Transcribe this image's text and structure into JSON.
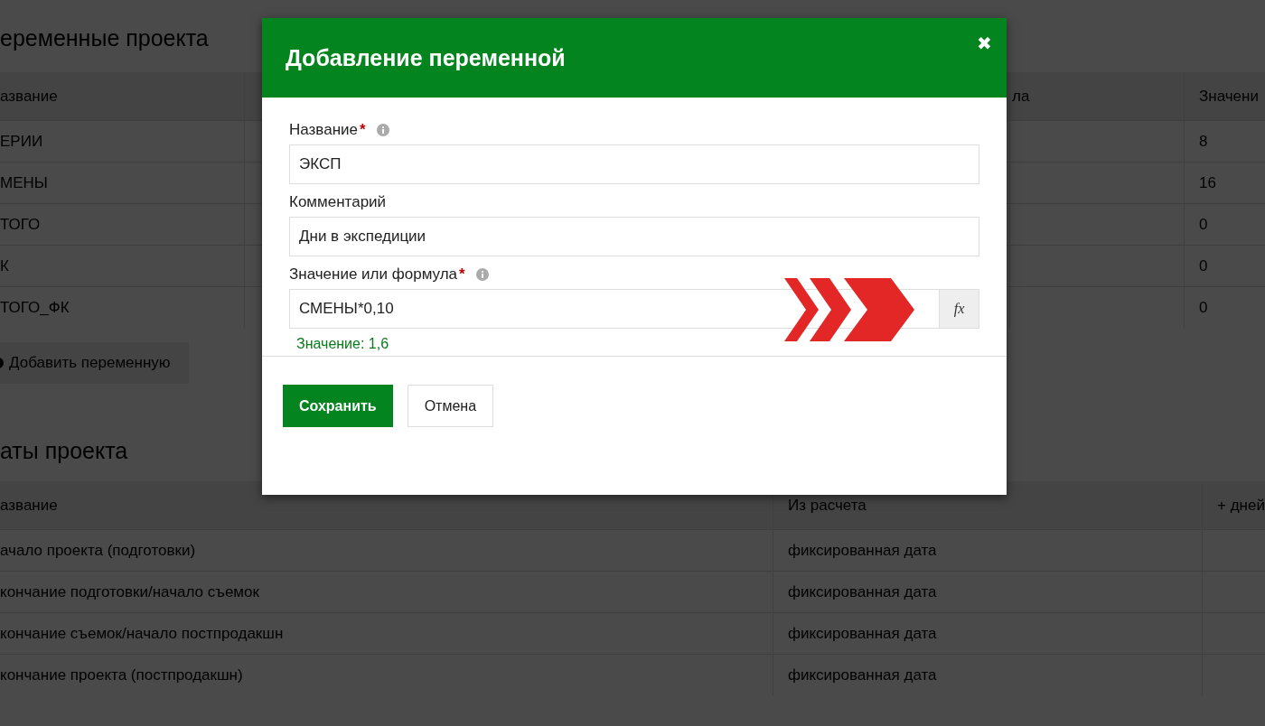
{
  "page": {
    "sections": [
      {
        "title": "еременные проекта",
        "table": {
          "columns": [
            {
              "label": "азвание"
            },
            {},
            {
              "label": "ла"
            },
            {
              "label": "Значени"
            }
          ],
          "rows": [
            [
              "ЕРИИ",
              null,
              null,
              "8"
            ],
            [
              "МЕНЫ",
              null,
              null,
              "16"
            ],
            [
              "ТОГО",
              null,
              null,
              "0"
            ],
            [
              "К",
              null,
              null,
              "0"
            ],
            [
              "ТОГО_ФК",
              null,
              null,
              "0"
            ]
          ]
        },
        "add_button": {
          "label": "Добавить переменную"
        }
      },
      {
        "title": "аты проекта",
        "table": {
          "columns": [
            {
              "label": "азвание"
            },
            {
              "label": "Из расчета"
            },
            {
              "label": "+ дней"
            }
          ],
          "rows": [
            [
              "ачало проекта (подготовки)",
              "фиксированная дата",
              null
            ],
            [
              "кончание подготовки/начало съемок",
              "фиксированная дата",
              null
            ],
            [
              "кончание съемок/начало постпродакшн",
              "фиксированная дата",
              null
            ],
            [
              "кончание проекта (постпродакшн)",
              "фиксированная дата",
              null
            ]
          ]
        }
      }
    ]
  },
  "dialog": {
    "title": "Добавление переменной",
    "close": "✖",
    "fields": [
      {
        "label": "Название",
        "required_mark": "*",
        "info": true,
        "value": "ЭКСП"
      },
      {
        "label": "Комментарий",
        "info": false,
        "value": "Дни в экспедиции"
      },
      {
        "label": "Значение или формула",
        "required_mark": "*",
        "info": true,
        "value": "СМЕНЫ*0,10",
        "addon": "fx",
        "hint": "Значение: 1,6",
        "annotation": true
      }
    ],
    "buttons": [
      {
        "label": "Сохранить",
        "kind": "primary"
      },
      {
        "label": "Отмена",
        "kind": "secondary"
      }
    ]
  }
}
